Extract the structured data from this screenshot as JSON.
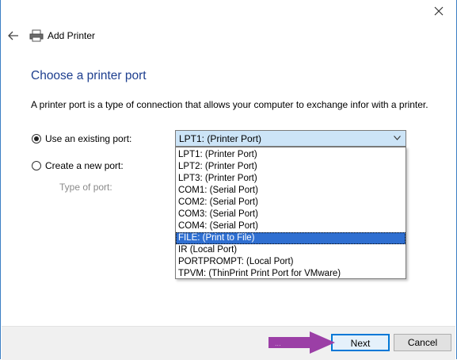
{
  "window": {
    "title": "Add Printer"
  },
  "page": {
    "heading": "Choose a printer port",
    "description": "A printer port is a type of connection that allows your computer to exchange infor with a printer."
  },
  "options": {
    "existing_label": "Use an existing port:",
    "new_label": "Create a new port:",
    "type_label": "Type of port:",
    "selected_port": "LPT1: (Printer Port)"
  },
  "ports": [
    "LPT1: (Printer Port)",
    "LPT2: (Printer Port)",
    "LPT3: (Printer Port)",
    "COM1: (Serial Port)",
    "COM2: (Serial Port)",
    "COM3: (Serial Port)",
    "COM4: (Serial Port)",
    "FILE: (Print to File)",
    "IR (Local Port)",
    "PORTPROMPT: (Local Port)",
    "TPVM: (ThinPrint Print Port for VMware)"
  ],
  "highlighted_port_index": 7,
  "buttons": {
    "next": "Next",
    "cancel": "Cancel"
  },
  "colors": {
    "heading": "#1e3f8f",
    "highlight": "#2f6fd1",
    "combo_bg": "#cce4f7",
    "overlay_arrow": "#9b3fa6"
  },
  "icons": {
    "close": "close-icon",
    "back": "back-arrow-icon",
    "printer": "printer-icon",
    "dropdown": "chevron-down-icon",
    "annotation": "purple-arrow-icon"
  }
}
